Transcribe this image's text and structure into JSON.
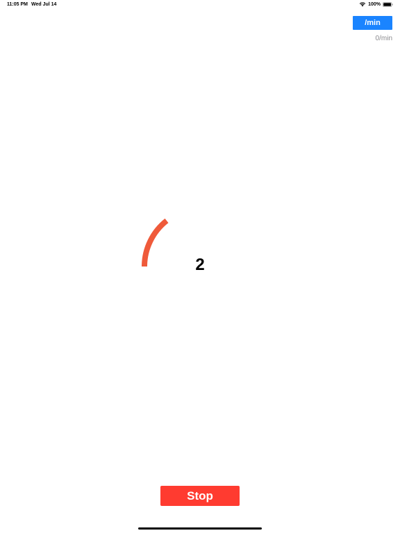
{
  "status_bar": {
    "time": "11:05 PM",
    "date": "Wed Jul 14",
    "battery_percent": "100%",
    "icons": [
      "wifi-icon",
      "battery-icon"
    ]
  },
  "toolbar": {
    "rate_button_label": "/min",
    "rate_readout": "0/min"
  },
  "timer": {
    "count": "2",
    "arc_color": "#ef5a3a"
  },
  "actions": {
    "stop_label": "Stop"
  },
  "colors": {
    "accent": "#1a84ff",
    "stop": "#ff3b30",
    "secondary_text": "#8a8a8e"
  }
}
